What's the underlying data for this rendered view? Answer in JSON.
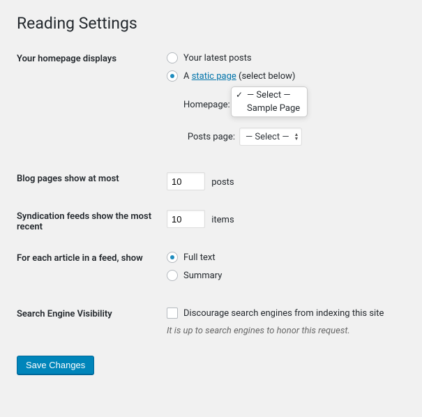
{
  "page_title": "Reading Settings",
  "homepage": {
    "label": "Your homepage displays",
    "option_latest": "Your latest posts",
    "option_static_prefix": "A ",
    "option_static_link": "static page",
    "option_static_suffix": " (select below)",
    "selected": "static",
    "homepage_label": "Homepage:",
    "posts_page_label": "Posts page:",
    "dropdown_options": {
      "select": "— Select —",
      "sample": "Sample Page"
    },
    "posts_page_value": "— Select —"
  },
  "blog_pages": {
    "label": "Blog pages show at most",
    "value": "10",
    "unit": "posts"
  },
  "syndication": {
    "label": "Syndication feeds show the most recent",
    "value": "10",
    "unit": "items"
  },
  "feed_article": {
    "label": "For each article in a feed, show",
    "option_full": "Full text",
    "option_summary": "Summary",
    "selected": "full"
  },
  "search_visibility": {
    "label": "Search Engine Visibility",
    "checkbox_label": "Discourage search engines from indexing this site",
    "description": "It is up to search engines to honor this request."
  },
  "save_button": "Save Changes"
}
